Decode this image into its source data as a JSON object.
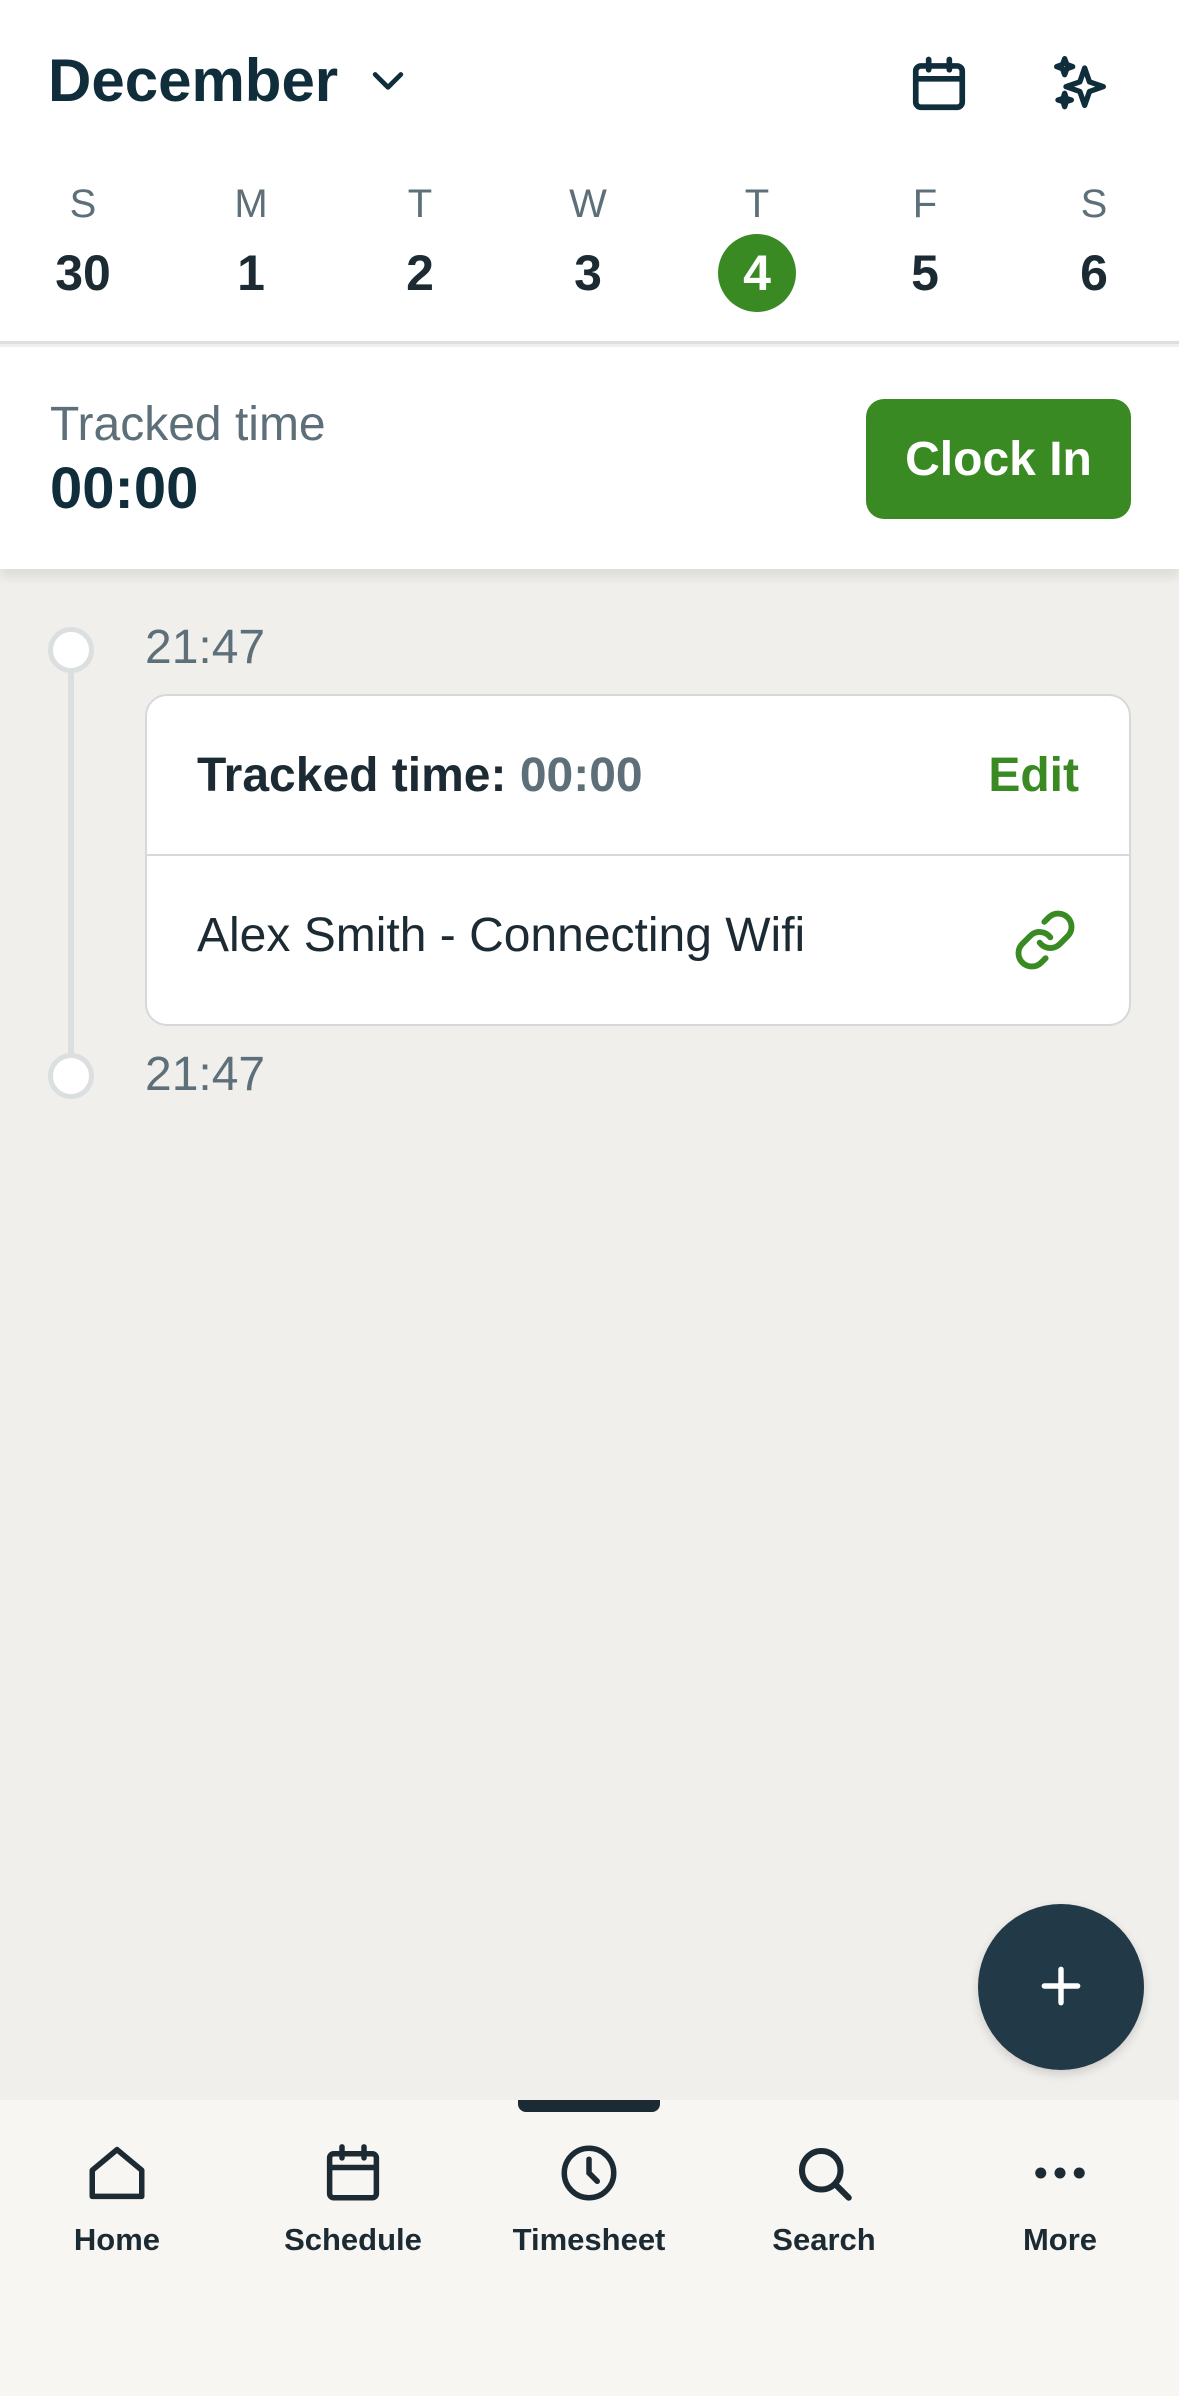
{
  "header": {
    "month": "December",
    "calendar_icon": "calendar-icon",
    "ai_icon": "sparkles-icon"
  },
  "week": [
    {
      "letter": "S",
      "num": "30"
    },
    {
      "letter": "M",
      "num": "1"
    },
    {
      "letter": "T",
      "num": "2"
    },
    {
      "letter": "W",
      "num": "3"
    },
    {
      "letter": "T",
      "num": "4",
      "selected": true
    },
    {
      "letter": "F",
      "num": "5"
    },
    {
      "letter": "S",
      "num": "6"
    }
  ],
  "tracked": {
    "label": "Tracked time",
    "value": "00:00",
    "clock_in_label": "Clock In"
  },
  "timeline": {
    "start_time": "21:47",
    "end_time": "21:47",
    "entry": {
      "tracked_label": "Tracked time:",
      "tracked_value": "00:00",
      "edit_label": "Edit",
      "job": "Alex Smith - Connecting Wifi",
      "link_icon": "link-icon"
    }
  },
  "fab": {
    "icon": "plus-icon"
  },
  "nav": [
    {
      "label": "Home",
      "icon": "home-icon"
    },
    {
      "label": "Schedule",
      "icon": "calendar-icon"
    },
    {
      "label": "Timesheet",
      "icon": "clock-icon",
      "active": true
    },
    {
      "label": "Search",
      "icon": "search-icon"
    },
    {
      "label": "More",
      "icon": "more-icon"
    }
  ],
  "colors": {
    "accent": "#3a8a24",
    "dark": "#0f2d3a",
    "fab": "#223a48",
    "muted": "#5d6f78",
    "background": "#f0efeb"
  }
}
